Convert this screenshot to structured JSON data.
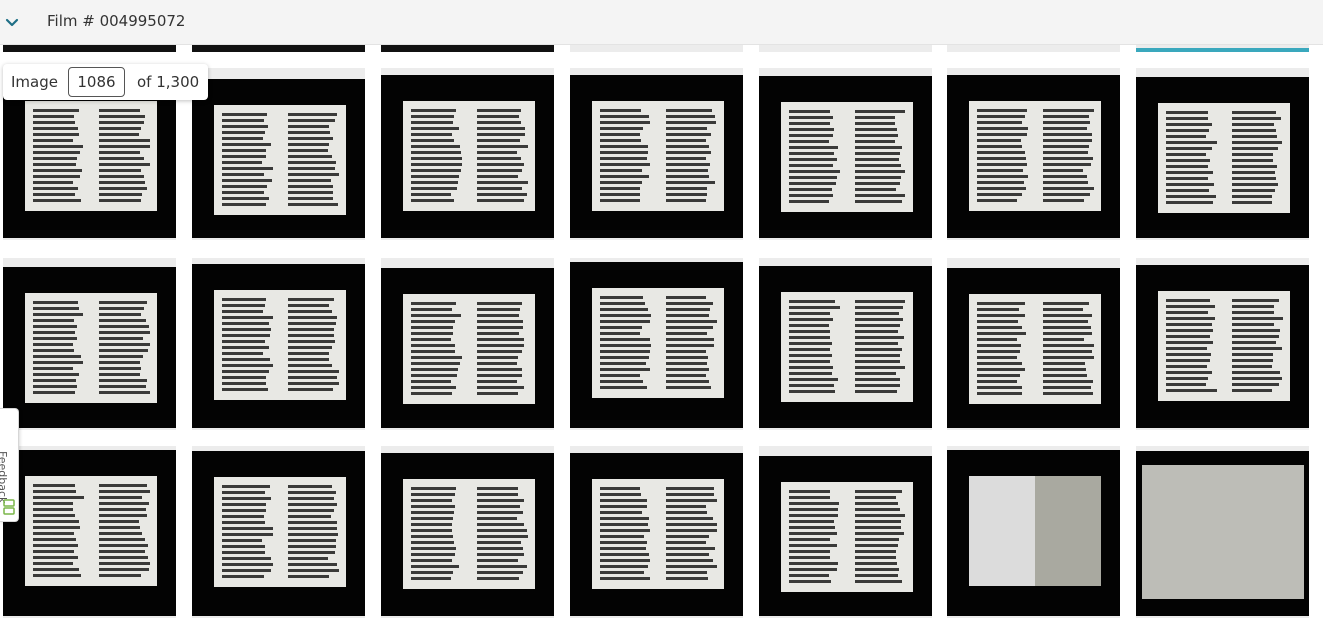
{
  "film": {
    "title": "Film # 004995072"
  },
  "navigator": {
    "image_label": "Image",
    "current_image": "1086",
    "of_label": "of 1,300"
  },
  "feedback": {
    "label": "Feedback"
  },
  "colors": {
    "selected_accent": "#3aa8bd",
    "header_bg": "#f4f4f4",
    "thumbnail_bg": "#030303"
  },
  "thumbnails": {
    "rows": 3,
    "columns": 7,
    "selected_top_strip_column": 6
  }
}
